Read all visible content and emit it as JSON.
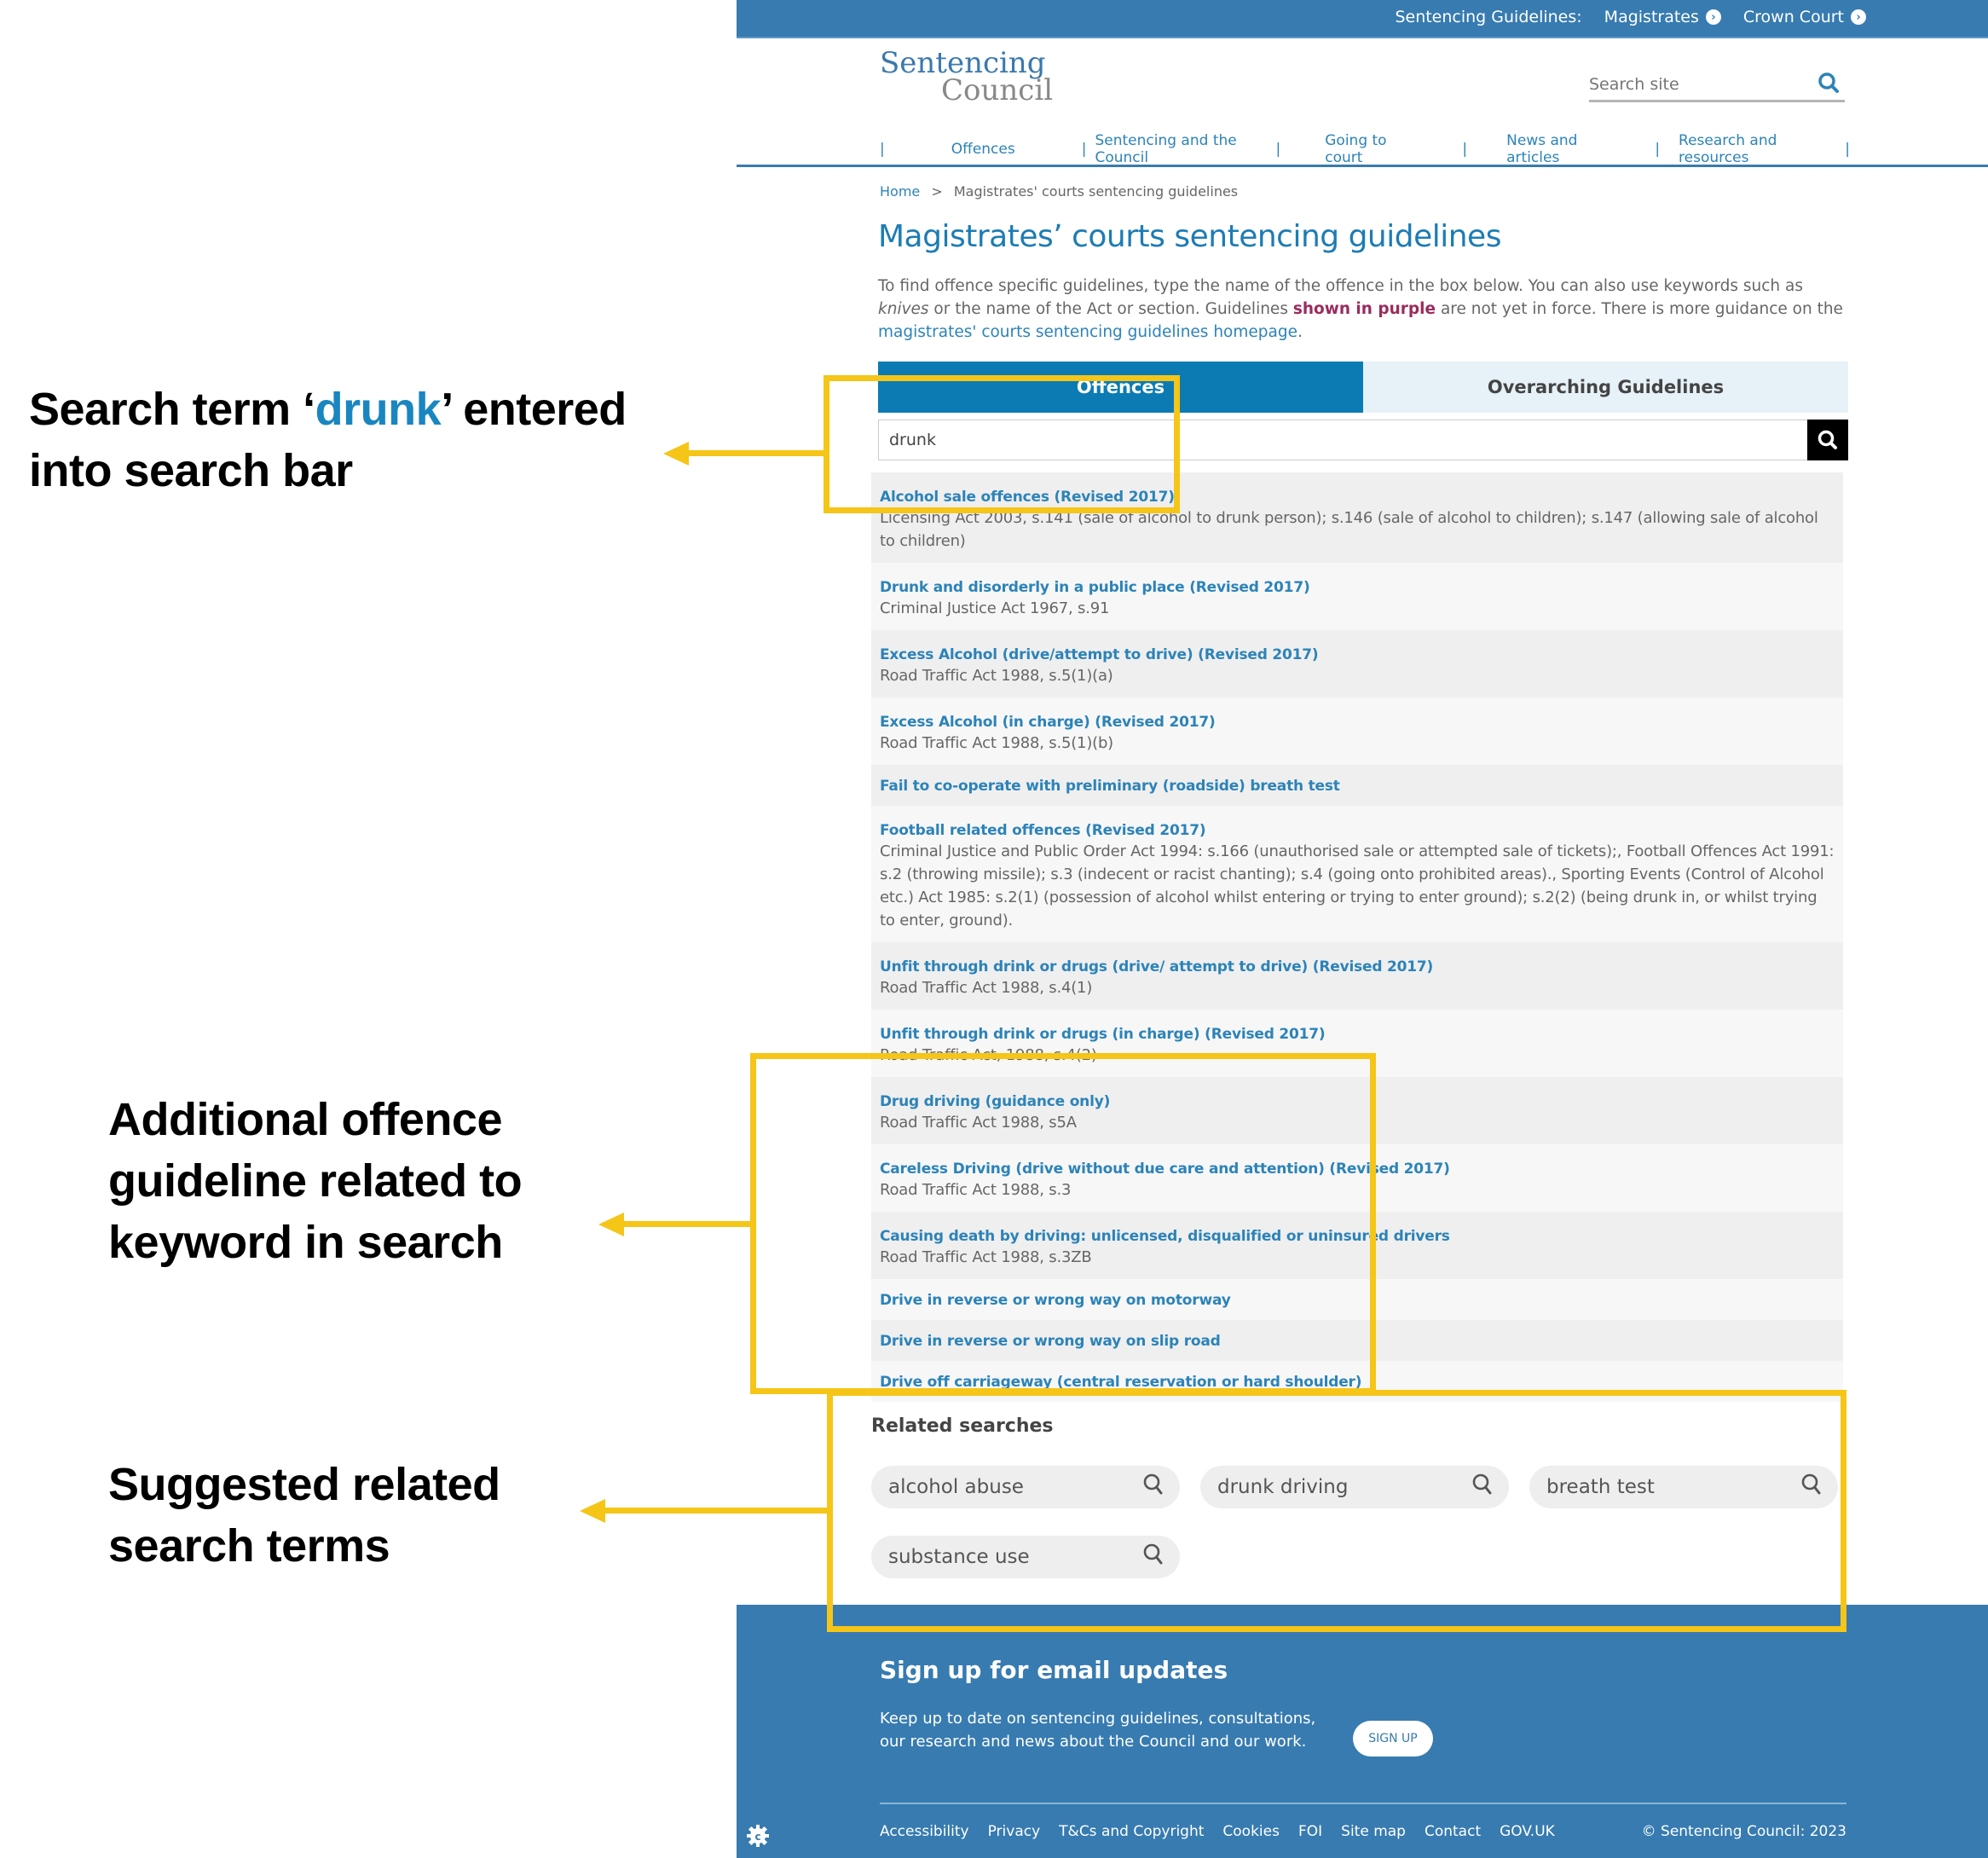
{
  "annotations": {
    "search_term": {
      "prefix": "Search term ‘",
      "highlight": "drunk",
      "suffix": "’ entered into search bar"
    },
    "additional": "Additional offence guideline related to keyword in search",
    "suggested": "Suggested related search terms",
    "accent_color": "#f5c518",
    "highlight_color": "#1a86c0"
  },
  "topbar": {
    "label": "Sentencing Guidelines:",
    "links": [
      "Magistrates",
      "Crown Court"
    ]
  },
  "header": {
    "logo_line1": "Sentencing",
    "logo_line2": "Council",
    "search_placeholder": "Search site"
  },
  "nav": {
    "items": [
      "Offences",
      "Sentencing and the Council",
      "Going to court",
      "News and articles",
      "Research and resources"
    ]
  },
  "breadcrumb": {
    "home": "Home",
    "separator": ">",
    "current": "Magistrates' courts sentencing guidelines"
  },
  "page": {
    "title": "Magistrates’ courts sentencing guidelines",
    "intro_1": "To find offence specific guidelines, type the name of the offence in the box below. You can also use keywords such as ",
    "intro_em": "knives",
    "intro_2": " or the name of the Act or section. Guidelines ",
    "intro_purple": "shown in purple",
    "intro_3": " are not yet in force. There is more guidance on the ",
    "intro_link": "magistrates' courts sentencing guidelines homepage",
    "intro_4": "."
  },
  "tabs": [
    {
      "label": "Offences",
      "active": true
    },
    {
      "label": "Overarching Guidelines",
      "active": false
    }
  ],
  "offence_search": {
    "value": "drunk"
  },
  "results": [
    {
      "title": "Alcohol sale offences (Revised 2017)",
      "desc": "Licensing Act 2003, s.141 (sale of alcohol to drunk person); s.146 (sale of alcohol to children); s.147 (allowing sale of alcohol to children)"
    },
    {
      "title": "Drunk and disorderly in a public place (Revised 2017)",
      "desc": "Criminal Justice Act 1967, s.91"
    },
    {
      "title": "Excess Alcohol (drive/attempt to drive) (Revised 2017)",
      "desc": "Road Traffic Act 1988, s.5(1)(a)"
    },
    {
      "title": "Excess Alcohol (in charge) (Revised 2017)",
      "desc": "Road Traffic Act 1988, s.5(1)(b)"
    },
    {
      "title": "Fail to co-operate with preliminary (roadside) breath test",
      "desc": ""
    },
    {
      "title": "Football related offences (Revised 2017)",
      "desc": "Criminal Justice and Public Order Act 1994: s.166 (unauthorised sale or attempted sale of tickets);, Football Offences Act 1991: s.2 (throwing missile); s.3 (indecent or racist chanting); s.4 (going onto prohibited areas)., Sporting Events (Control of Alcohol etc.) Act 1985: s.2(1) (possession of alcohol whilst entering or trying to enter ground); s.2(2) (being drunk in, or whilst trying to enter, ground)."
    },
    {
      "title": "Unfit through drink or drugs (drive/ attempt to drive) (Revised 2017)",
      "desc": "Road Traffic Act 1988, s.4(1)"
    },
    {
      "title": "Unfit through drink or drugs (in charge) (Revised 2017)",
      "desc": "Road Traffic Act, 1988, s.4(2)"
    },
    {
      "title": "Drug driving (guidance only)",
      "desc": "Road Traffic Act 1988, s5A"
    },
    {
      "title": "Careless Driving (drive without due care and attention) (Revised 2017)",
      "desc": "Road Traffic Act 1988, s.3"
    },
    {
      "title": "Causing death by driving: unlicensed, disqualified or uninsured drivers",
      "desc": "Road Traffic Act 1988, s.3ZB"
    },
    {
      "title": "Drive in reverse or wrong way on motorway",
      "desc": ""
    },
    {
      "title": "Drive in reverse or wrong way on slip road",
      "desc": ""
    },
    {
      "title": "Drive off carriageway (central reservation or hard shoulder)",
      "desc": ""
    }
  ],
  "related": {
    "heading": "Related searches",
    "chips": [
      "alcohol abuse",
      "drunk driving",
      "breath test",
      "substance use"
    ]
  },
  "footer": {
    "heading": "Sign up for email updates",
    "text": "Keep up to date on sentencing guidelines, consultations, our research and news about the Council and our work.",
    "signup_label": "SIGN UP",
    "links": [
      "Accessibility",
      "Privacy",
      "T&Cs and Copyright",
      "Cookies",
      "FOI",
      "Site map",
      "Contact",
      "GOV.UK"
    ],
    "copyright": "© Sentencing Council: 2023"
  },
  "colors": {
    "brand_blue": "#377bb0",
    "link_blue": "#2c83b8",
    "active_tab": "#0c7bb3",
    "purple": "#9a2c5e"
  }
}
